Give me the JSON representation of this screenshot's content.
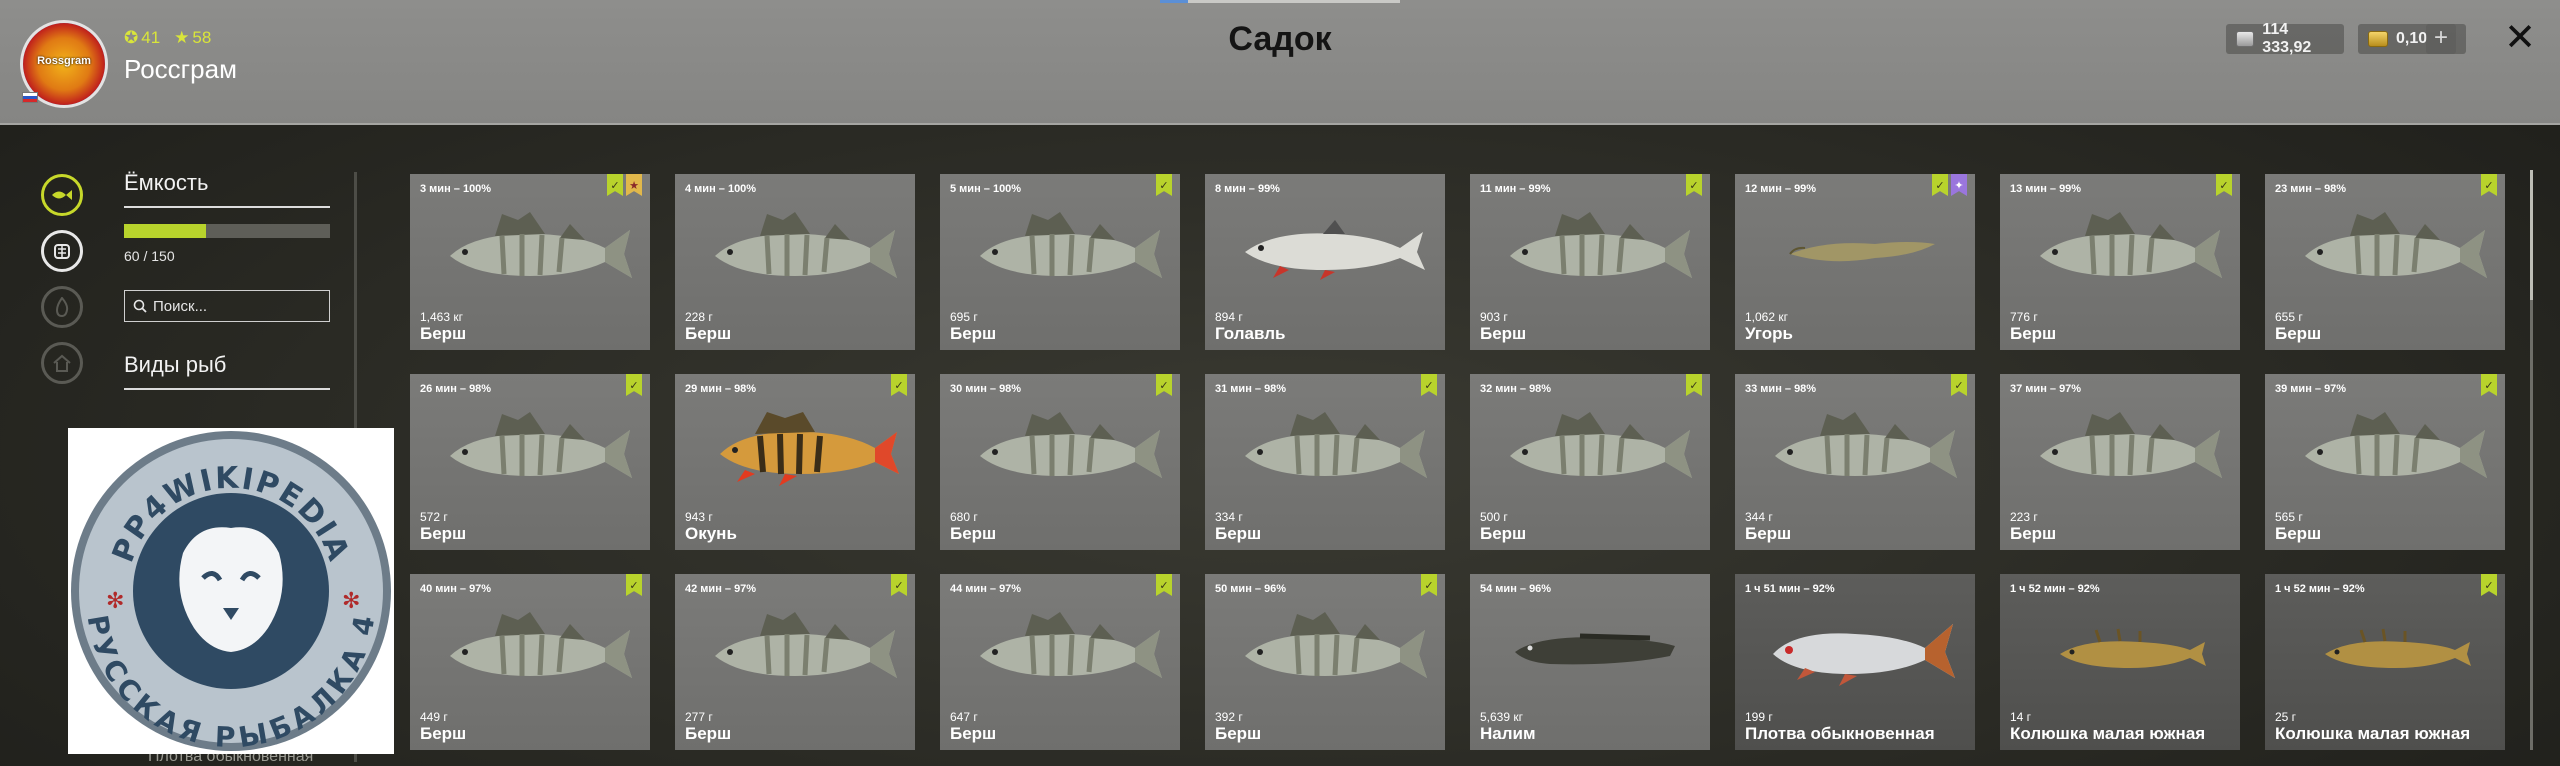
{
  "header": {
    "title": "Садок",
    "user": {
      "name": "Россграм",
      "level": "41",
      "stars": "58",
      "avatar_text": "Rossgram"
    },
    "currency": {
      "silver": "114 333,92",
      "gold": "0,10"
    },
    "close_symbol": "✕",
    "plus_symbol": "+"
  },
  "sidebar": {
    "capacity_title": "Ёмкость",
    "capacity_value": "60 / 150",
    "capacity_fraction": 0.4,
    "search_placeholder": "Поиск...",
    "species_title": "Виды рыб",
    "partially_hidden_item": "Плотва обыкновенная",
    "icons": [
      "fish-icon",
      "keepnet-icon",
      "fire-icon",
      "home-icon"
    ]
  },
  "watermark": {
    "top_text": "PP4WIKIPEDIA",
    "bottom_text": "РУССКАЯ РЫБАЛКА 4"
  },
  "fish": [
    {
      "time": "3 мин – 100%",
      "weight": "1,463 кг",
      "name": "Берш",
      "tags": [
        "green",
        "gold"
      ],
      "type": "perch"
    },
    {
      "time": "4 мин – 100%",
      "weight": "228 г",
      "name": "Берш",
      "tags": [],
      "type": "perch"
    },
    {
      "time": "5 мин – 100%",
      "weight": "695 г",
      "name": "Берш",
      "tags": [
        "green"
      ],
      "type": "perch"
    },
    {
      "time": "8 мин – 99%",
      "weight": "894 г",
      "name": "Голавль",
      "tags": [],
      "type": "chub"
    },
    {
      "time": "11 мин – 99%",
      "weight": "903 г",
      "name": "Берш",
      "tags": [
        "green"
      ],
      "type": "perch"
    },
    {
      "time": "12 мин – 99%",
      "weight": "1,062 кг",
      "name": "Угорь",
      "tags": [
        "green",
        "purple"
      ],
      "type": "eel"
    },
    {
      "time": "13 мин – 99%",
      "weight": "776 г",
      "name": "Берш",
      "tags": [
        "green"
      ],
      "type": "perch"
    },
    {
      "time": "23 мин – 98%",
      "weight": "655 г",
      "name": "Берш",
      "tags": [
        "green"
      ],
      "type": "perch"
    },
    {
      "time": "26 мин – 98%",
      "weight": "572 г",
      "name": "Берш",
      "tags": [
        "green"
      ],
      "type": "perch"
    },
    {
      "time": "29 мин – 98%",
      "weight": "943 г",
      "name": "Окунь",
      "tags": [
        "green"
      ],
      "type": "redperch"
    },
    {
      "time": "30 мин – 98%",
      "weight": "680 г",
      "name": "Берш",
      "tags": [
        "green"
      ],
      "type": "perch"
    },
    {
      "time": "31 мин – 98%",
      "weight": "334 г",
      "name": "Берш",
      "tags": [
        "green"
      ],
      "type": "perch"
    },
    {
      "time": "32 мин – 98%",
      "weight": "500 г",
      "name": "Берш",
      "tags": [
        "green"
      ],
      "type": "perch"
    },
    {
      "time": "33 мин – 98%",
      "weight": "344 г",
      "name": "Берш",
      "tags": [
        "green"
      ],
      "type": "perch"
    },
    {
      "time": "37 мин – 97%",
      "weight": "223 г",
      "name": "Берш",
      "tags": [],
      "type": "perch"
    },
    {
      "time": "39 мин – 97%",
      "weight": "565 г",
      "name": "Берш",
      "tags": [
        "green"
      ],
      "type": "perch"
    },
    {
      "time": "40 мин – 97%",
      "weight": "449 г",
      "name": "Берш",
      "tags": [
        "green"
      ],
      "type": "perch"
    },
    {
      "time": "42 мин – 97%",
      "weight": "277 г",
      "name": "Берш",
      "tags": [
        "green"
      ],
      "type": "perch"
    },
    {
      "time": "44 мин – 97%",
      "weight": "647 г",
      "name": "Берш",
      "tags": [
        "green"
      ],
      "type": "perch"
    },
    {
      "time": "50 мин – 96%",
      "weight": "392 г",
      "name": "Берш",
      "tags": [
        "green"
      ],
      "type": "perch"
    },
    {
      "time": "54 мин – 96%",
      "weight": "5,639 кг",
      "name": "Налим",
      "tags": [],
      "type": "burbot"
    },
    {
      "time": "1 ч 51 мин – 92%",
      "weight": "199 г",
      "name": "Плотва обыкновенная",
      "tags": [],
      "type": "roach"
    },
    {
      "time": "1 ч 52 мин – 92%",
      "weight": "14 г",
      "name": "Колюшка малая южная",
      "tags": [],
      "type": "stickle"
    },
    {
      "time": "1 ч 52 мин – 92%",
      "weight": "25 г",
      "name": "Колюшка малая южная",
      "tags": [
        "green"
      ],
      "type": "stickle"
    }
  ]
}
